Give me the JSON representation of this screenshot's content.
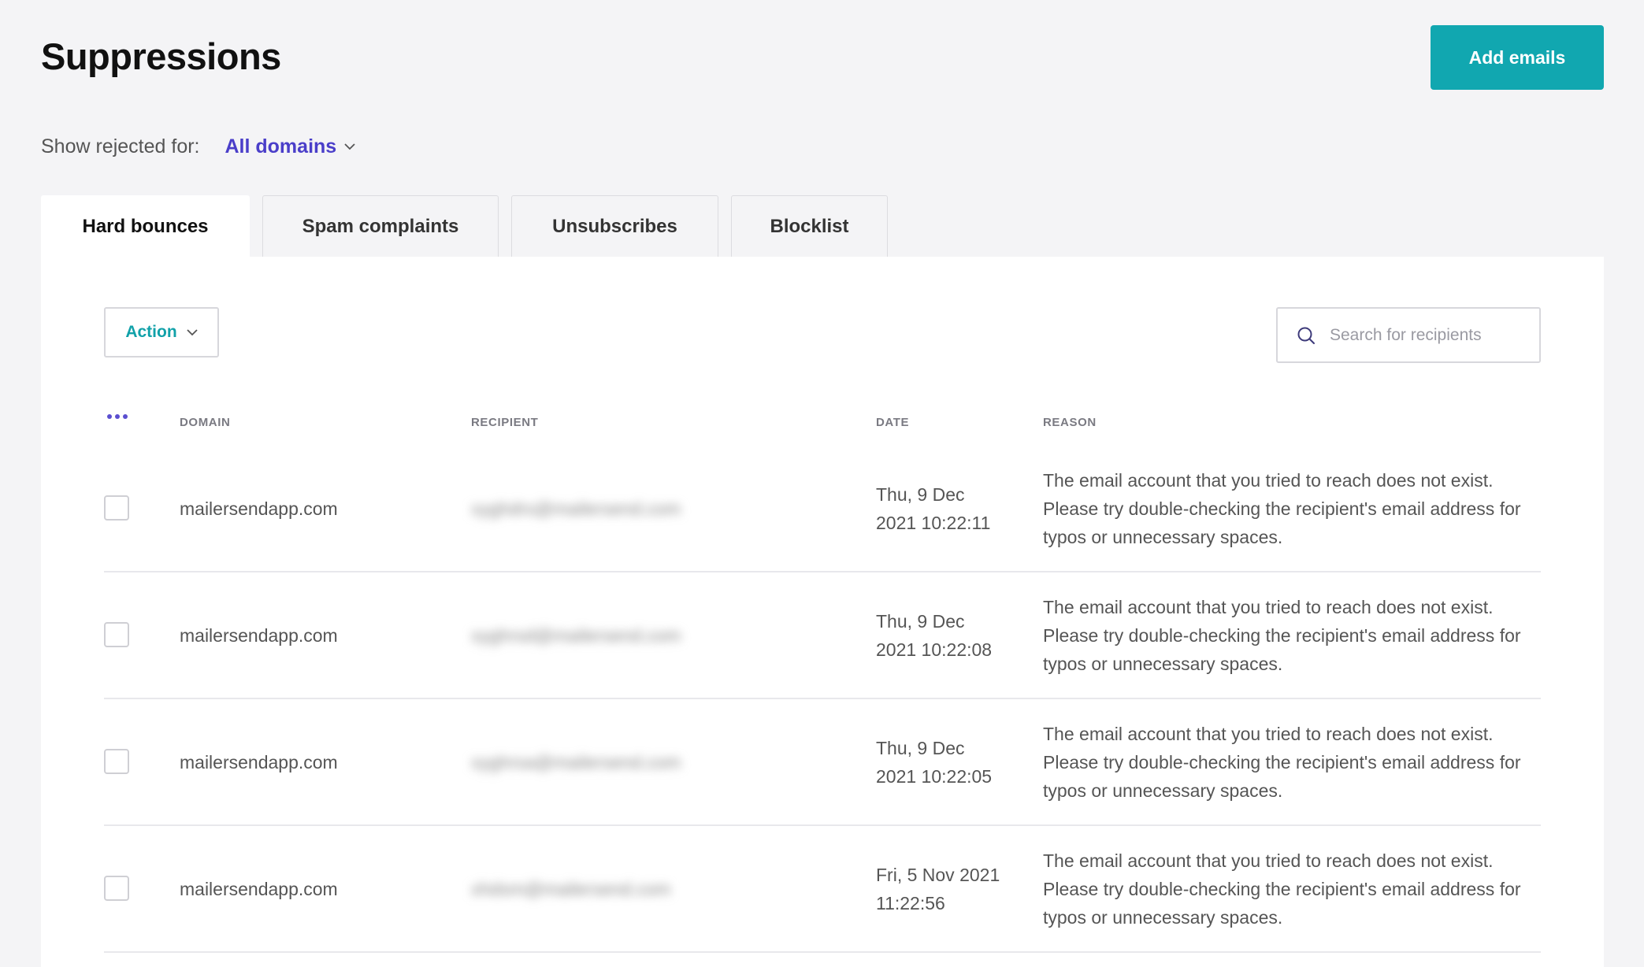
{
  "page": {
    "title": "Suppressions",
    "add_button_label": "Add emails"
  },
  "filter": {
    "label": "Show rejected for:",
    "selected": "All domains"
  },
  "tabs": [
    {
      "label": "Hard bounces",
      "active": true
    },
    {
      "label": "Spam complaints",
      "active": false
    },
    {
      "label": "Unsubscribes",
      "active": false
    },
    {
      "label": "Blocklist",
      "active": false
    }
  ],
  "toolbar": {
    "action_label": "Action",
    "search_placeholder": "Search for recipients"
  },
  "table": {
    "headers": {
      "domain": "DOMAIN",
      "recipient": "RECIPIENT",
      "date": "DATE",
      "reason": "REASON"
    },
    "rows": [
      {
        "domain": "mailersendapp.com",
        "recipient": "xyghdrs@mailersend.com",
        "date": "Thu, 9 Dec 2021 10:22:11",
        "reason": "The email account that you tried to reach does not exist. Please try double-checking the recipient's email address for typos or unnecessary spaces."
      },
      {
        "domain": "mailersendapp.com",
        "recipient": "xyghrsd@mailersend.com",
        "date": "Thu, 9 Dec 2021 10:22:08",
        "reason": "The email account that you tried to reach does not exist. Please try double-checking the recipient's email address for typos or unnecessary spaces."
      },
      {
        "domain": "mailersendapp.com",
        "recipient": "xyghrsa@mailersend.com",
        "date": "Thu, 9 Dec 2021 10:22:05",
        "reason": "The email account that you tried to reach does not exist. Please try double-checking the recipient's email address for typos or unnecessary spaces."
      },
      {
        "domain": "mailersendapp.com",
        "recipient": "xhdsm@mailersend.com",
        "date": "Fri, 5 Nov 2021 11:22:56",
        "reason": "The email account that you tried to reach does not exist. Please try double-checking the recipient's email address for typos or unnecessary spaces."
      }
    ]
  },
  "colors": {
    "accent": "#11a7b0",
    "link": "#4a3ec9",
    "background": "#f4f4f6"
  },
  "icons": {
    "filter_dropdown": "chevron-down-icon",
    "action_dropdown": "chevron-down-icon",
    "search": "search-icon",
    "column_menu": "more-dots-icon"
  }
}
